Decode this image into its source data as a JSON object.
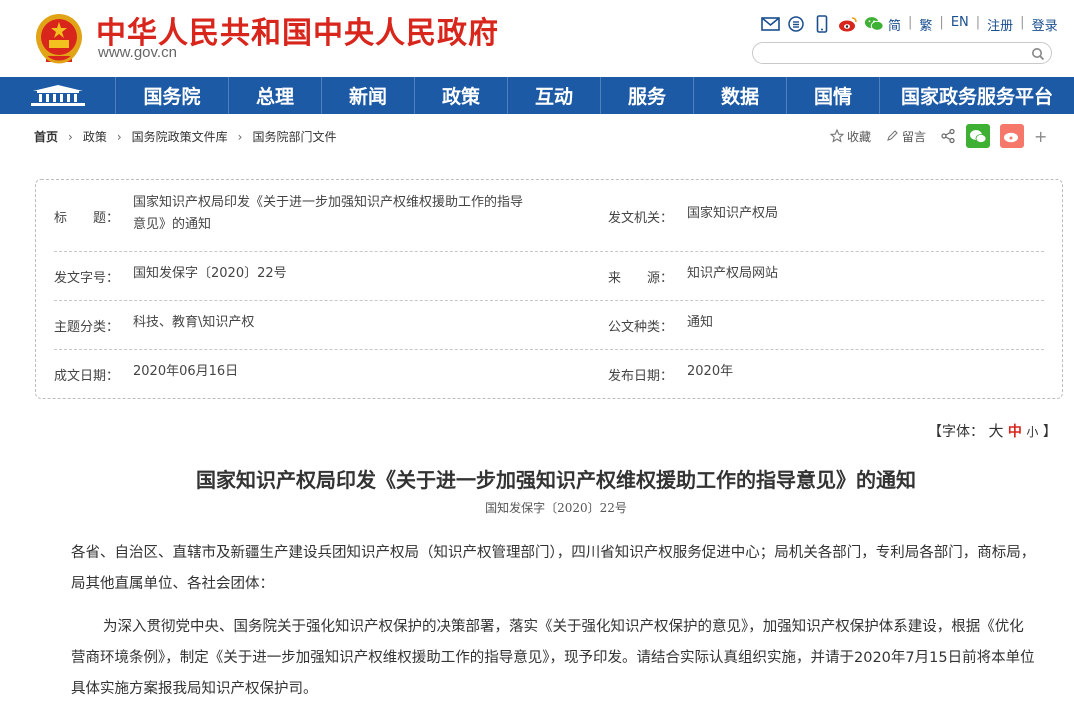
{
  "header": {
    "site_title": "中华人民共和国中央人民政府",
    "site_url": "www.gov.cn",
    "lang_links": [
      "简",
      "繁",
      "EN",
      "注册",
      "登录"
    ],
    "search_placeholder": ""
  },
  "nav": {
    "items": [
      "国务院",
      "总理",
      "新闻",
      "政策",
      "互动",
      "服务",
      "数据",
      "国情",
      "国家政务服务平台"
    ]
  },
  "breadcrumb": [
    "首页",
    "政策",
    "国务院政策文件库",
    "国务院部门文件"
  ],
  "tools": {
    "favorite": "收藏",
    "comment": "留言"
  },
  "info": {
    "title_label": "标　　题：",
    "title_value": "国家知识产权局印发《关于进一步加强知识产权维权援助工作的指导意见》的通知",
    "issuer_label": "发文机关：",
    "issuer_value": "国家知识产权局",
    "docno_label": "发文字号：",
    "docno_value": "国知发保字〔2020〕22号",
    "source_label": "来　　源：",
    "source_value": "知识产权局网站",
    "topic_label": "主题分类：",
    "topic_value": "科技、教育\\知识产权",
    "doctype_label": "公文种类：",
    "doctype_value": "通知",
    "date_label": "成文日期：",
    "date_value": "2020年06月16日",
    "pub_label": "发布日期：",
    "pub_value": "2020年"
  },
  "fontsize": {
    "prefix": "【字体：",
    "big": "大",
    "mid": "中",
    "small": "小",
    "suffix": "】"
  },
  "article": {
    "title": "国家知识产权局印发《关于进一步加强知识产权维权援助工作的指导意见》的通知",
    "doc_number": "国知发保字〔2020〕22号",
    "para1": "各省、自治区、直辖市及新疆生产建设兵团知识产权局（知识产权管理部门），四川省知识产权服务促进中心；局机关各部门，专利局各部门，商标局，局其他直属单位、各社会团体：",
    "para2": "为深入贯彻党中央、国务院关于强化知识产权保护的决策部署，落实《关于强化知识产权保护的意见》，加强知识产权保护体系建设，根据《优化营商环境条例》，制定《关于进一步加强知识产权维权援助工作的指导意见》，现予印发。请结合实际认真组织实施，并请于2020年7月15日前将本单位具体实施方案报我局知识产权保护司。"
  },
  "colors": {
    "brand_red": "#d8261c",
    "nav_blue": "#1c5aa6",
    "wechat_green": "#3eb135",
    "weibo_red": "#f5786b"
  }
}
